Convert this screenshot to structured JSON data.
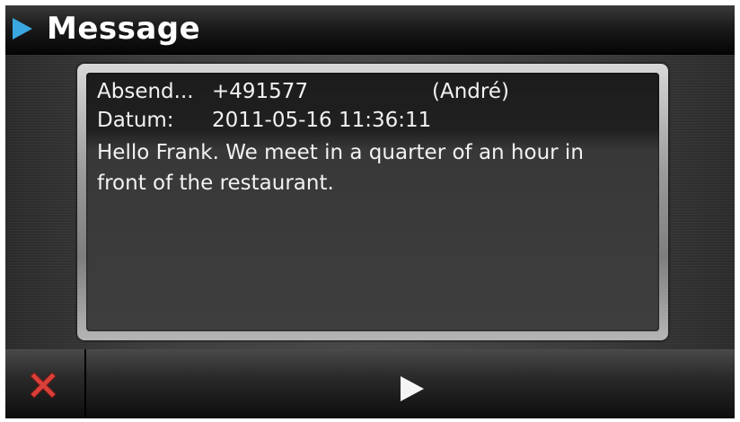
{
  "window": {
    "title": "Message"
  },
  "message": {
    "sender_label": "Absend...",
    "sender_number": "+491577",
    "sender_name": "(André)",
    "date_label": "Datum:",
    "date_value": "2011-05-16 11:36:11",
    "text": "Hello Frank. We meet in a quarter of an hour in front of the restaurant."
  },
  "toolbar": {
    "close_icon": "close-x-icon",
    "next_icon": "play-arrow-icon"
  },
  "colors": {
    "accent_arrow": "#3aa7e0",
    "close_red": "#d9403a"
  }
}
